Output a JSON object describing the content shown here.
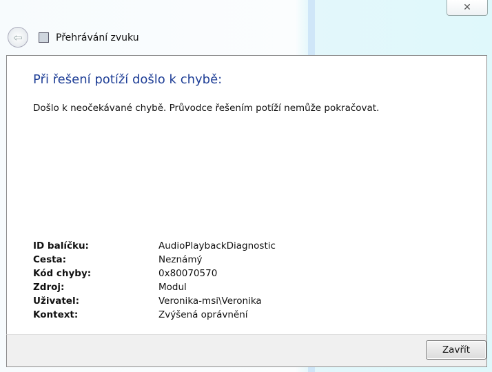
{
  "window": {
    "title": "Přehrávání zvuku",
    "close_label": "✕"
  },
  "heading": "Při řešení potíží došlo k chybě:",
  "message": "Došlo k neočekávané chybě. Průvodce řešením potíží nemůže pokračovat.",
  "details": [
    {
      "label": "ID balíčku:",
      "value": "AudioPlaybackDiagnostic"
    },
    {
      "label": "Cesta:",
      "value": "Neznámý"
    },
    {
      "label": "Kód chyby:",
      "value": "0x80070570"
    },
    {
      "label": "Zdroj:",
      "value": "Modul"
    },
    {
      "label": "Uživatel:",
      "value": "Veronika-msi\\Veronika"
    },
    {
      "label": "Kontext:",
      "value": "Zvýšená oprávnění"
    }
  ],
  "buttons": {
    "close": "Zavřít"
  }
}
